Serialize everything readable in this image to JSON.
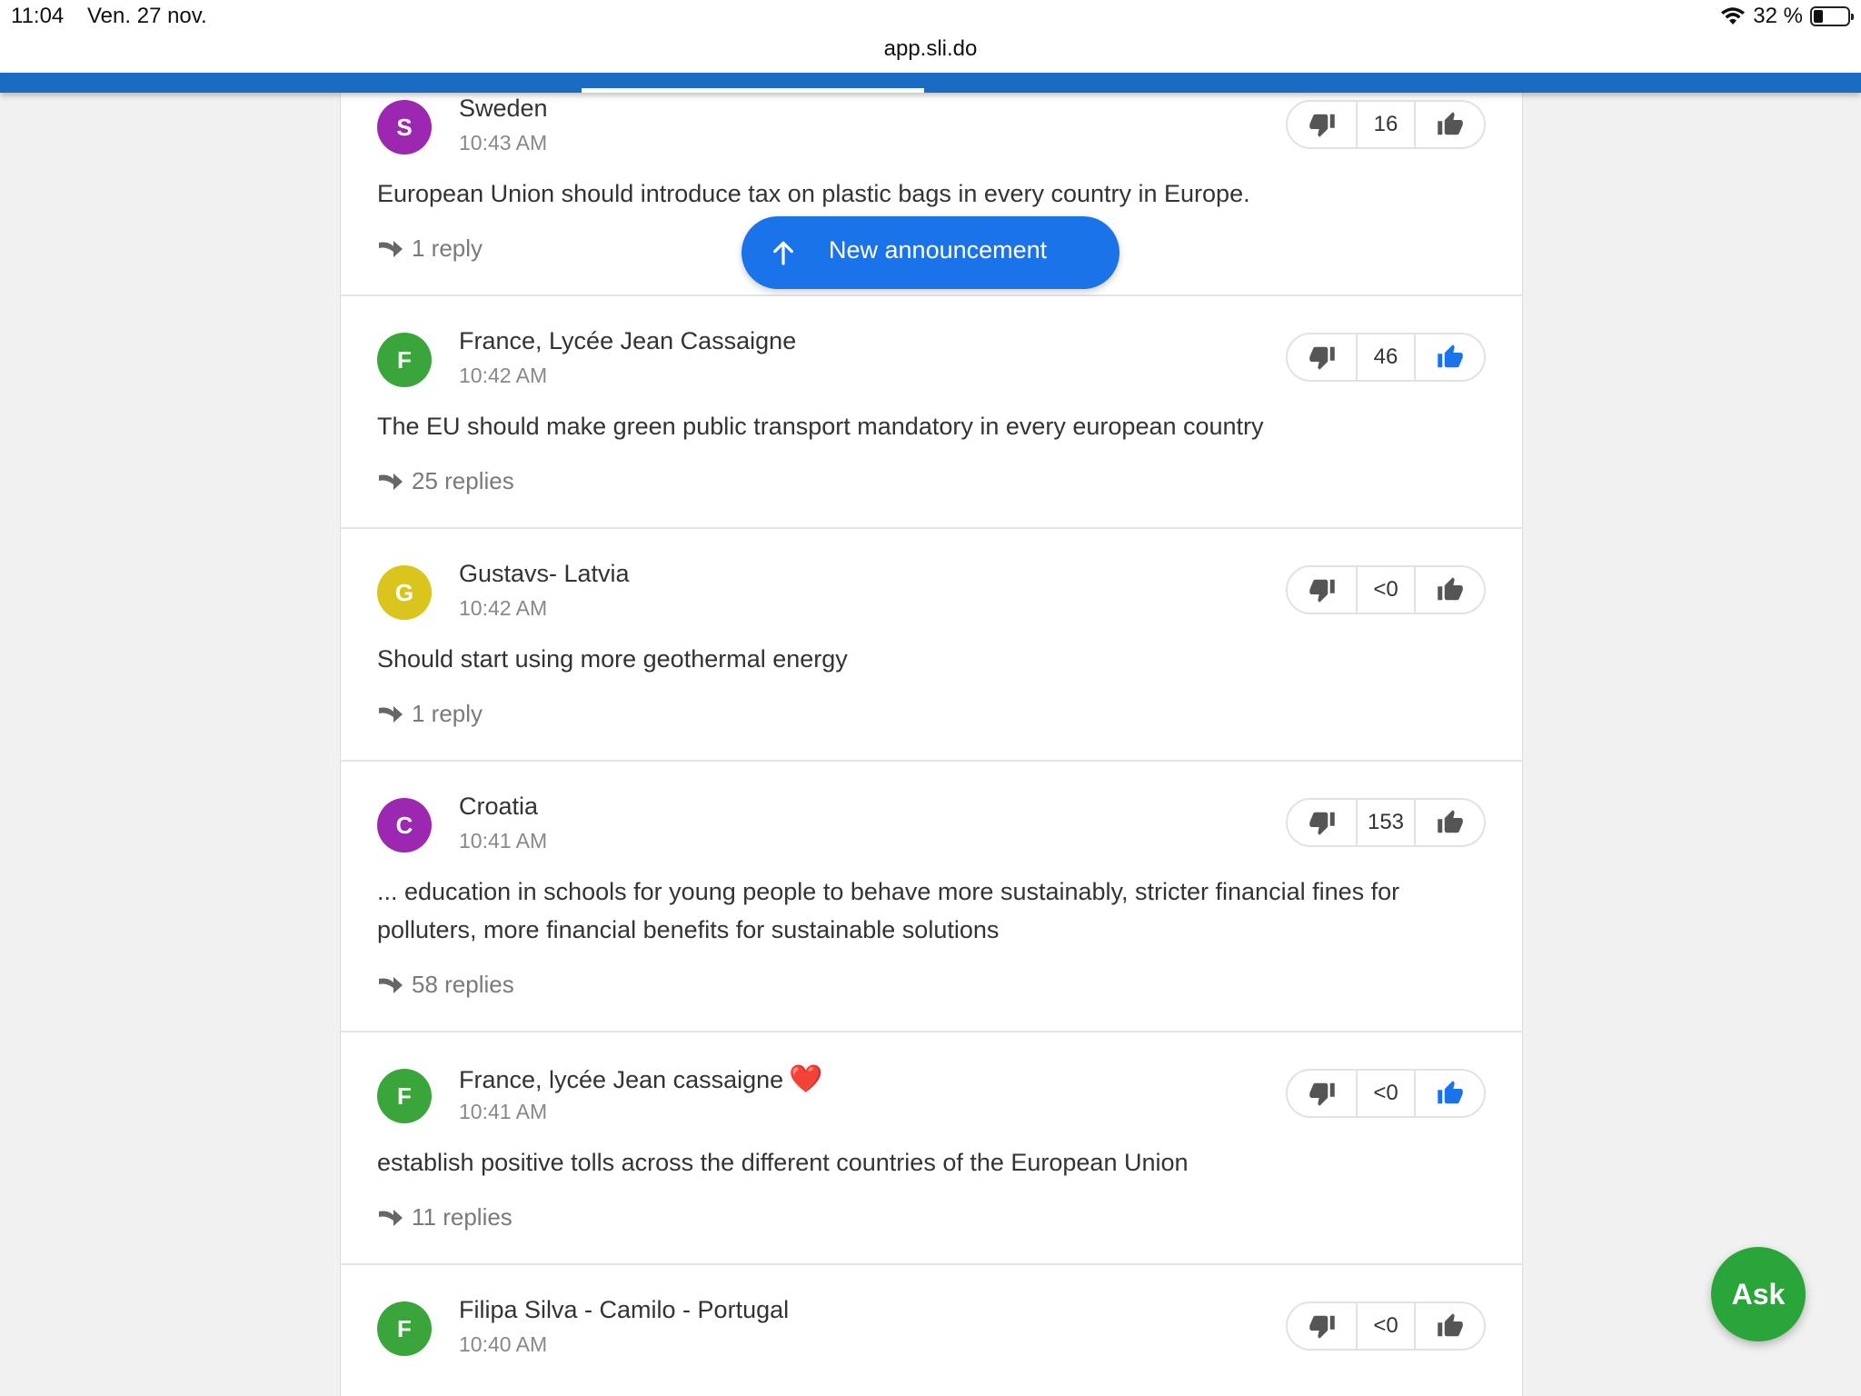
{
  "status_bar": {
    "time": "11:04",
    "date": "Ven. 27 nov.",
    "battery": "32 %",
    "url": "app.sli.do"
  },
  "announcement": {
    "label": "New announcement"
  },
  "ask_button": {
    "label": "Ask"
  },
  "colors": {
    "accent": "#1a73e8",
    "header_band": "#1a6cc2",
    "ask": "#2aa53a",
    "liked": "#1a73e8",
    "neutral_icon": "#555555"
  },
  "questions": [
    {
      "initial": "S",
      "avatar_color": "#9c27b0",
      "author": "Sweden",
      "time": "10:43 AM",
      "text": "European Union should introduce tax on plastic bags in every country in Europe.",
      "replies": "1 reply",
      "votes": "16",
      "liked": false
    },
    {
      "initial": "F",
      "avatar_color": "#3aa53a",
      "author": "France, Lycée Jean Cassaigne",
      "time": "10:42 AM",
      "text": "The EU should make green public transport mandatory in every european country",
      "replies": "25 replies",
      "votes": "46",
      "liked": true
    },
    {
      "initial": "G",
      "avatar_color": "#d9c51c",
      "author": "Gustavs- Latvia",
      "time": "10:42 AM",
      "text": "Should start using more geothermal energy",
      "replies": "1 reply",
      "votes": "<0",
      "liked": false
    },
    {
      "initial": "C",
      "avatar_color": "#9c27b0",
      "author": "Croatia",
      "time": "10:41 AM",
      "text": "... education in schools for young people to behave more sustainably, stricter financial fines for polluters, more financial benefits for sustainable solutions",
      "replies": "58 replies",
      "votes": "153",
      "liked": false
    },
    {
      "initial": "F",
      "avatar_color": "#3aa53a",
      "author": "France, lycée Jean cassaigne",
      "author_emoji": "❤️",
      "time": "10:41 AM",
      "text": "establish positive tolls across the different countries of the European Union",
      "replies": "11 replies",
      "votes": "<0",
      "liked": true
    },
    {
      "initial": "F",
      "avatar_color": "#3aa53a",
      "author": "Filipa Silva - Camilo - Portugal",
      "time": "10:40 AM",
      "text": "",
      "replies": "",
      "votes": "<0",
      "liked": false
    }
  ]
}
